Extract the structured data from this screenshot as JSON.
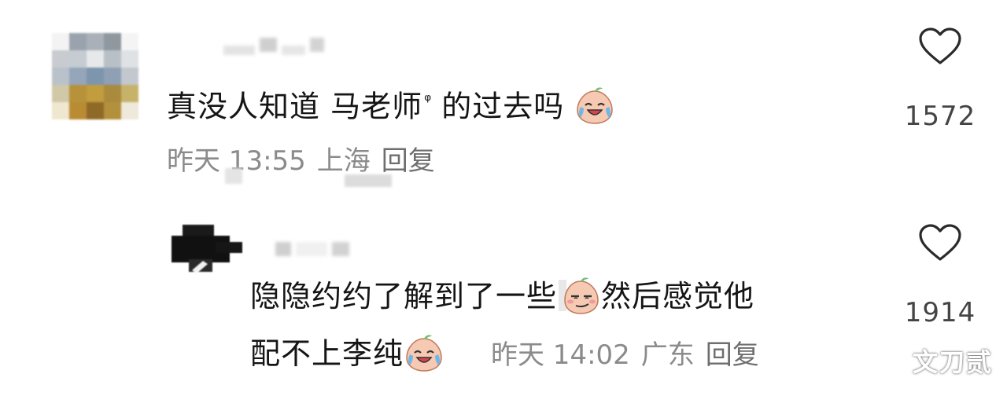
{
  "comments": [
    {
      "text_before": "真没人知道 马老师",
      "search_mark": "ᵠ",
      "text_after": "的过去吗",
      "emoji": "crying-laughing-emoji",
      "time": "昨天 13:55",
      "location": "上海",
      "reply_label": "回复",
      "likes": "1572"
    },
    {
      "line1_before": "隐隐约约了解到了一些",
      "line1_emoji": "smirk-emoji",
      "line1_after": "然后感觉他",
      "line2": "配不上李纯",
      "line2_emoji": "crying-laughing-emoji",
      "time": "昨天 14:02",
      "location": "广东",
      "reply_label": "回复",
      "likes": "1914"
    }
  ],
  "watermark": "文刀贰",
  "colors": {
    "text": "#151515",
    "meta": "#8b8b8b",
    "heart_stroke": "#2a2a2a",
    "background": "#ffffff"
  }
}
